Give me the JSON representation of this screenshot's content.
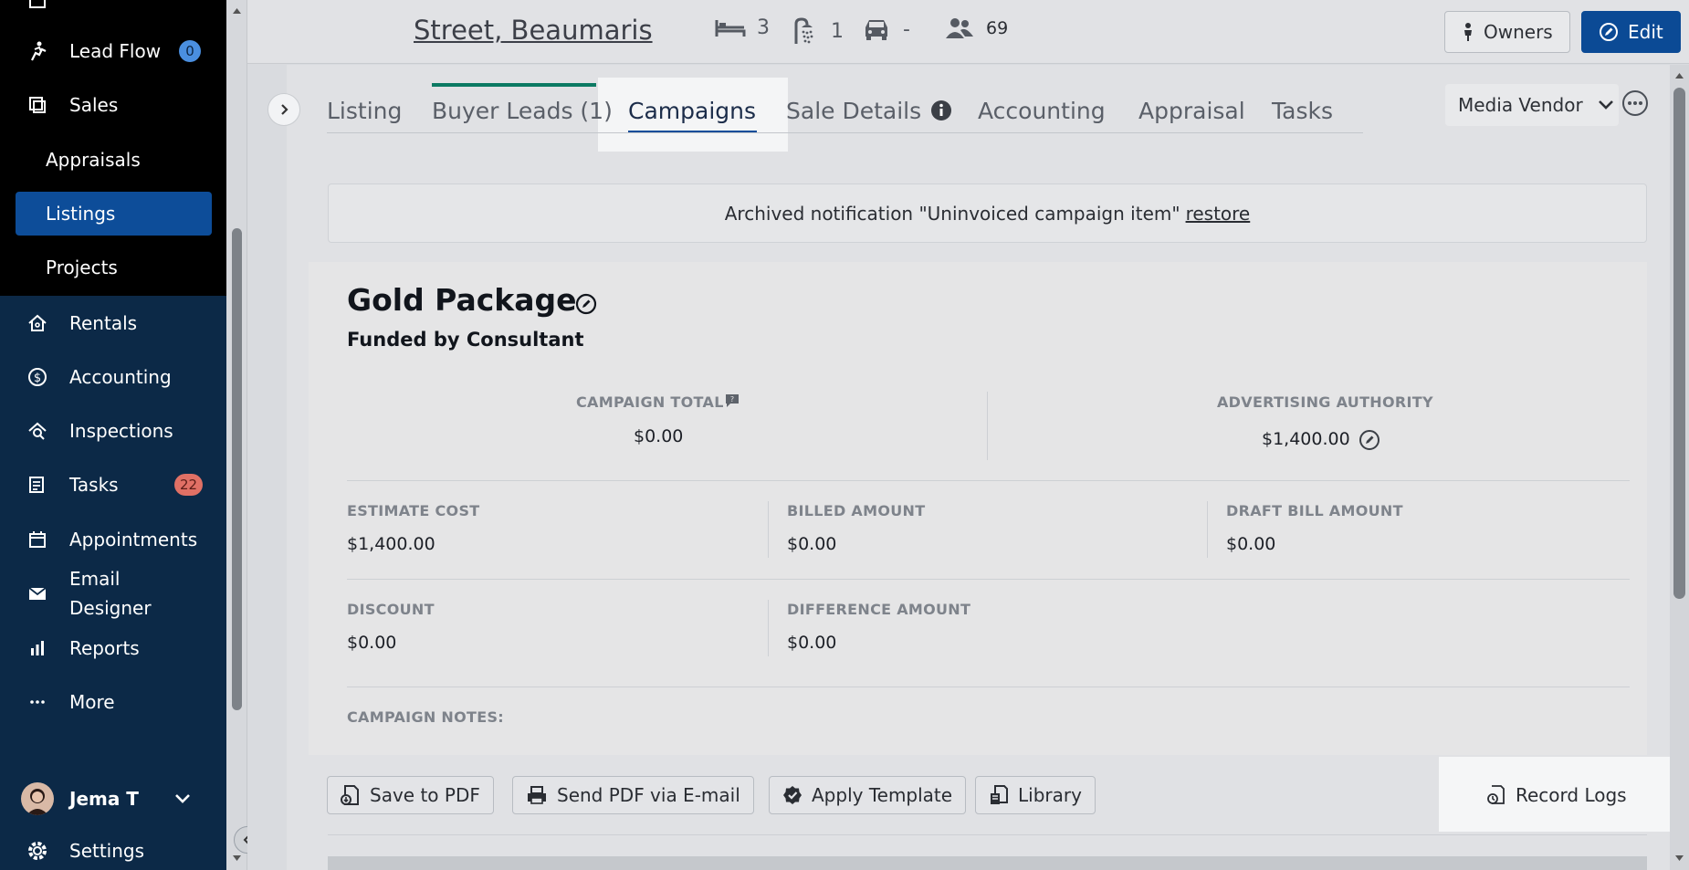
{
  "sidebar": {
    "items": [
      {
        "label": "Lead Flow",
        "badge": "0",
        "icon": "lead-flow-icon"
      },
      {
        "label": "Sales",
        "icon": "sales-icon"
      },
      {
        "label": "Rentals",
        "icon": "home-icon"
      },
      {
        "label": "Accounting",
        "icon": "dollar-icon"
      },
      {
        "label": "Inspections",
        "icon": "inspection-icon"
      },
      {
        "label": "Tasks",
        "badge": "22",
        "icon": "tasks-icon"
      },
      {
        "label": "Appointments",
        "icon": "calendar-icon"
      },
      {
        "label": "Email",
        "label2": "Designer",
        "icon": "mail-icon"
      },
      {
        "label": "Reports",
        "icon": "bar-chart-icon"
      },
      {
        "label": "More",
        "icon": "ellipsis-icon"
      }
    ],
    "sales_sub": [
      "Appraisals",
      "Listings",
      "Projects"
    ],
    "user": {
      "name": "Jema T"
    },
    "settings_label": "Settings"
  },
  "header": {
    "address": "Street, Beaumaris",
    "beds": "3",
    "baths": "1",
    "cars": "-",
    "people": "69",
    "owners_label": "Owners",
    "edit_label": "Edit"
  },
  "tabs": [
    "Listing",
    "Buyer Leads (1)",
    "Campaigns",
    "Sale Details",
    "Accounting",
    "Appraisal",
    "Tasks"
  ],
  "active_tab": "Campaigns",
  "vendor_select": "Media Vendor",
  "notification": {
    "text": "Archived notification \"Uninvoiced campaign item\"",
    "link": "restore"
  },
  "campaign": {
    "title": "Gold Package",
    "funded_by": "Funded by Consultant",
    "campaign_total_label": "CAMPAIGN TOTAL",
    "campaign_total": "$0.00",
    "advertising_authority_label": "ADVERTISING AUTHORITY",
    "advertising_authority": "$1,400.00",
    "estimate_cost_label": "ESTIMATE COST",
    "estimate_cost": "$1,400.00",
    "billed_amount_label": "BILLED AMOUNT",
    "billed_amount": "$0.00",
    "draft_bill_label": "DRAFT BILL AMOUNT",
    "draft_bill": "$0.00",
    "discount_label": "DISCOUNT",
    "discount": "$0.00",
    "difference_label": "DIFFERENCE AMOUNT",
    "difference": "$0.00",
    "notes_label": "CAMPAIGN NOTES:"
  },
  "actions": {
    "save_pdf": "Save to PDF",
    "send_pdf": "Send PDF via E-mail",
    "apply_template": "Apply Template",
    "library": "Library",
    "record_logs": "Record Logs"
  },
  "colors": {
    "sidebar_bg": "#0c2947",
    "active_blue": "#0d4d99",
    "tab_accent": "#0c7a63",
    "badge_blue": "#4a8fe0",
    "badge_red": "#e07065"
  }
}
